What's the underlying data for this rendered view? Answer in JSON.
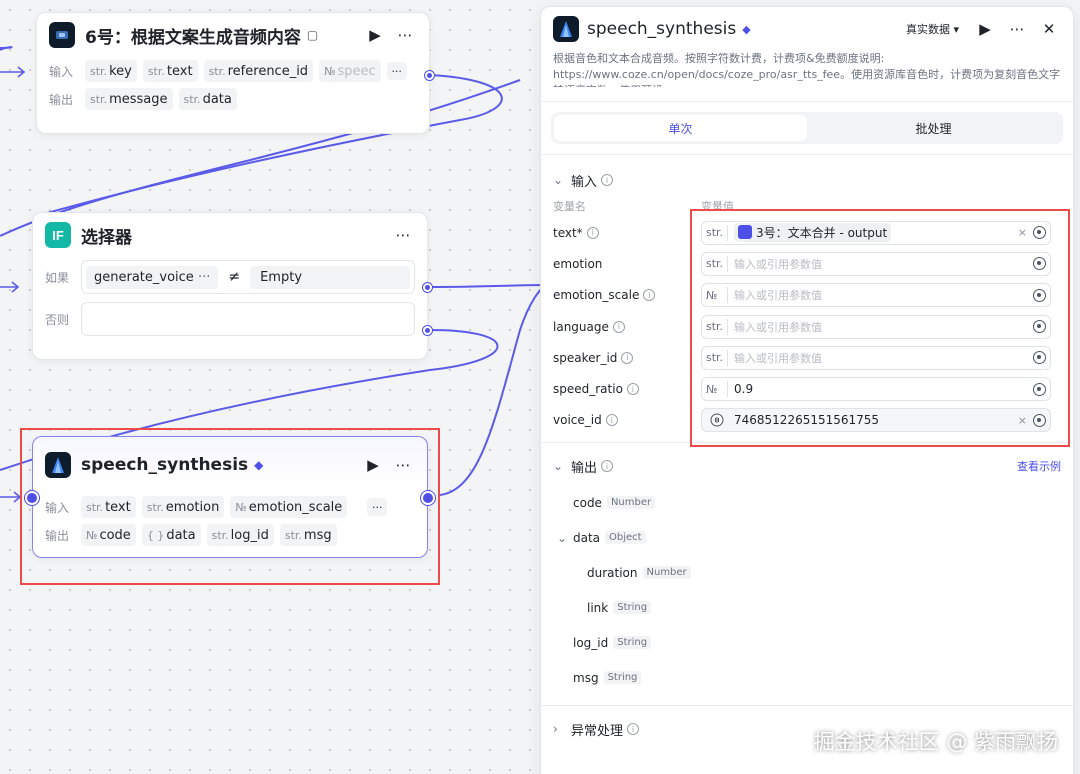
{
  "node_generate": {
    "title": "6号：根据文案生成音频内容",
    "input_label": "输入",
    "output_label": "输出",
    "inputs": [
      {
        "type": "str.",
        "name": "key"
      },
      {
        "type": "str.",
        "name": "text"
      },
      {
        "type": "str.",
        "name": "reference_id"
      },
      {
        "type": "№",
        "name": "speec"
      }
    ],
    "outputs": [
      {
        "type": "str.",
        "name": "message"
      },
      {
        "type": "str.",
        "name": "data"
      }
    ]
  },
  "node_selector": {
    "title": "选择器",
    "if_label": "如果",
    "else_label": "否则",
    "condition_var": "generate_voice",
    "condition_more": "···",
    "condition_op": "≠",
    "condition_value": "Empty"
  },
  "node_speech": {
    "title": "speech_synthesis",
    "input_label": "输入",
    "output_label": "输出",
    "inputs": [
      {
        "type": "str.",
        "name": "text"
      },
      {
        "type": "str.",
        "name": "emotion"
      },
      {
        "type": "№",
        "name": "emotion_scale"
      }
    ],
    "outputs": [
      {
        "type": "№",
        "name": "code"
      },
      {
        "type": "{ }",
        "name": "data"
      },
      {
        "type": "str.",
        "name": "log_id"
      },
      {
        "type": "str.",
        "name": "msg"
      }
    ]
  },
  "panel": {
    "title": "speech_synthesis",
    "data_mode": "真实数据",
    "description": "根据音色和文本合成音频。按照字符数计费，计费项&免费额度说明: https://www.coze.cn/open/docs/coze_pro/asr_tts_fee。使用资源库音色时，计费项为复刻音色文字转语音字数；使用预设...",
    "tabs": [
      "单次",
      "批处理"
    ],
    "input_section": "输入",
    "col_name": "变量名",
    "col_value": "变量值",
    "placeholder": "输入或引用参数值",
    "params": [
      {
        "name": "text*",
        "type": "str.",
        "ref": "3号：文本合并 - output"
      },
      {
        "name": "emotion",
        "type": "str.",
        "value": ""
      },
      {
        "name": "emotion_scale",
        "type": "№",
        "value": ""
      },
      {
        "name": "language",
        "type": "str.",
        "value": ""
      },
      {
        "name": "speaker_id",
        "type": "str.",
        "value": ""
      },
      {
        "name": "speed_ratio",
        "type": "№",
        "value": "0.9"
      },
      {
        "name": "voice_id",
        "type": "voice",
        "value": "7468512265151561755"
      }
    ],
    "output_section": "输出",
    "view_example": "查看示例",
    "outputs": [
      {
        "name": "code",
        "type": "Number",
        "indent": 0
      },
      {
        "name": "data",
        "type": "Object",
        "indent": 0,
        "expanded": true
      },
      {
        "name": "duration",
        "type": "Number",
        "indent": 1
      },
      {
        "name": "link",
        "type": "String",
        "indent": 1
      },
      {
        "name": "log_id",
        "type": "String",
        "indent": 0
      },
      {
        "name": "msg",
        "type": "String",
        "indent": 0
      }
    ],
    "exception_section": "异常处理"
  },
  "watermark": "掘金技术社区 @ 紫雨飘扬",
  "colors": {
    "accent": "#4e4ee8",
    "highlight": "#ee4a4a",
    "teal": "#14b8a6"
  }
}
